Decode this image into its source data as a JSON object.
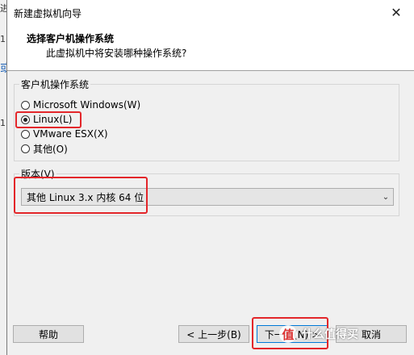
{
  "background": {
    "fragments": [
      "进",
      "1(",
      "或",
      "1("
    ]
  },
  "window": {
    "title": "新建虚拟机向导",
    "close_glyph": "✕"
  },
  "header": {
    "title": "选择客户机操作系统",
    "subtitle": "此虚拟机中将安装哪种操作系统?"
  },
  "os_group": {
    "legend": "客户机操作系统",
    "options": [
      {
        "label": "Microsoft Windows(W)",
        "checked": false
      },
      {
        "label": "Linux(L)",
        "checked": true
      },
      {
        "label": "VMware ESX(X)",
        "checked": false
      },
      {
        "label": "其他(O)",
        "checked": false
      }
    ]
  },
  "version_group": {
    "legend": "版本(V)",
    "selected": "其他 Linux 3.x 内核 64 位"
  },
  "buttons": {
    "help": "帮助",
    "back": "< 上一步(B)",
    "next": "下一步(N) >",
    "cancel": "取消"
  },
  "watermark": {
    "logo_glyph": "值",
    "text": "什么值得买"
  },
  "colors": {
    "highlight_box": "#e3262a",
    "default_button_border": "#0078d7"
  }
}
